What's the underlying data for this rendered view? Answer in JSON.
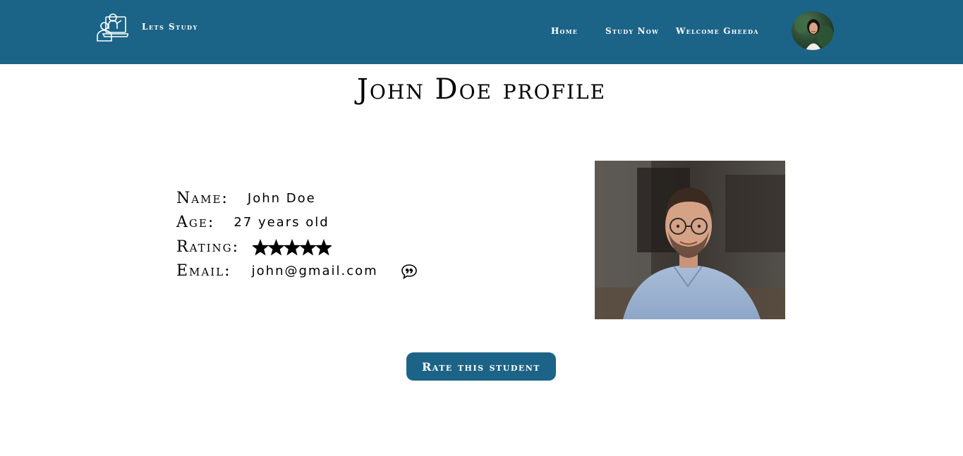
{
  "navbar": {
    "brand": "Lets Study",
    "logo_icon": "teacher-laptop-icon",
    "links": [
      {
        "label": "Home"
      },
      {
        "label": "Study Now"
      },
      {
        "label": "Welcome Gheeda"
      }
    ],
    "background": "#1c6487"
  },
  "page": {
    "title": "John Doe profile"
  },
  "profile": {
    "name_label": "Name:",
    "name_value": "John Doe",
    "age_label": "Age:",
    "age_value": "27 years old",
    "rating_label": "Rating:",
    "rating_value": 5,
    "rating_max": 5,
    "email_label": "Email:",
    "email_value": "john@gmail.com",
    "message_icon": "quote-bubble-icon"
  },
  "actions": {
    "rate_button": "Rate this student"
  },
  "colors": {
    "accent": "#1c6487",
    "text": "#000000"
  }
}
